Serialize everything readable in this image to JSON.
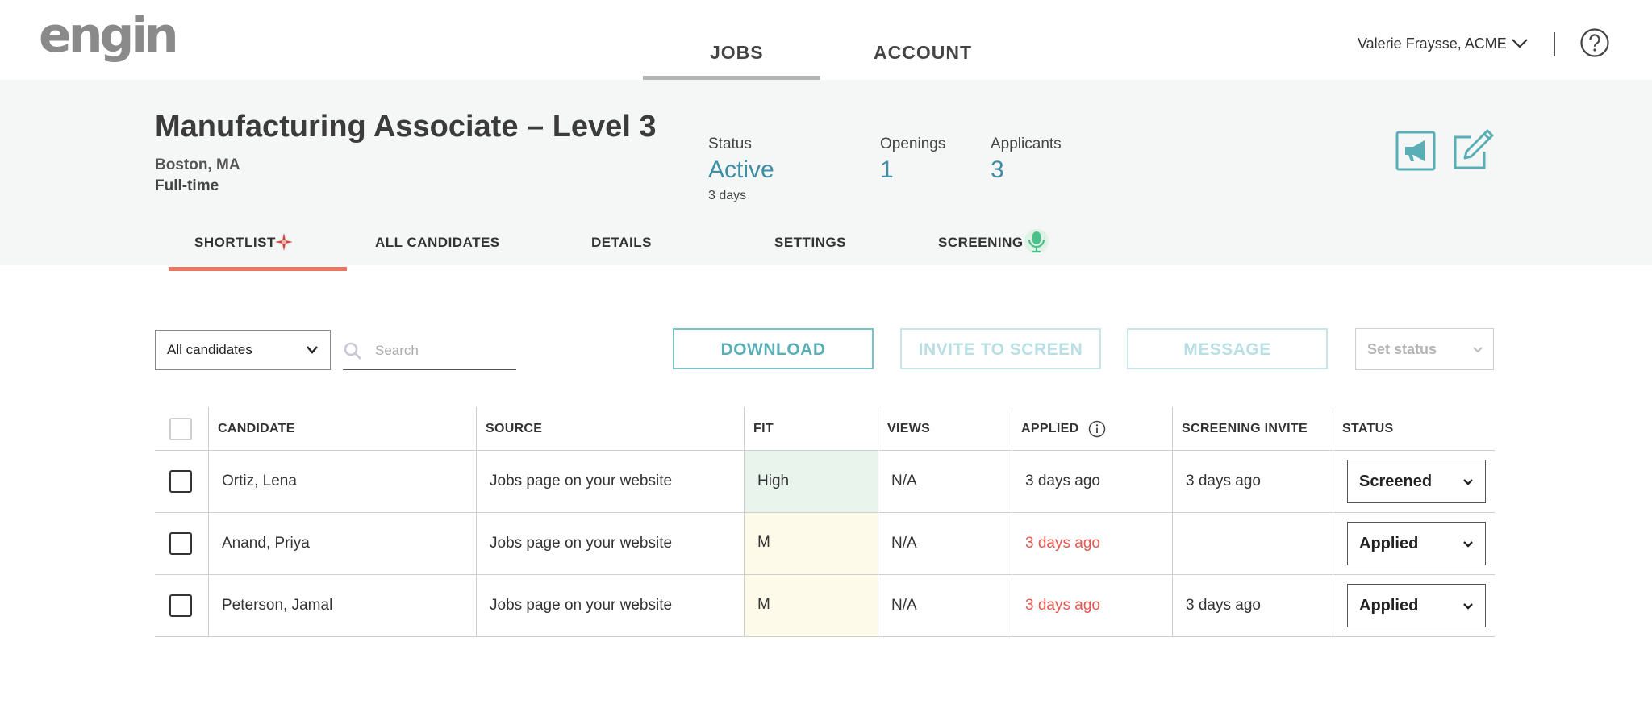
{
  "app": {
    "logo": "engin"
  },
  "nav": {
    "tabs": [
      "JOBS",
      "ACCOUNT"
    ],
    "active": "JOBS"
  },
  "user": {
    "name": "Valerie Fraysse, ACME"
  },
  "job": {
    "title": "Manufacturing Associate – Level 3",
    "location": "Boston, MA",
    "type": "Full-time",
    "status_label": "Status",
    "status_value": "Active",
    "status_age": "3 days",
    "openings_label": "Openings",
    "openings_value": "1",
    "applicants_label": "Applicants",
    "applicants_value": "3"
  },
  "subtabs": [
    "SHORTLIST",
    "ALL CANDIDATES",
    "DETAILS",
    "SETTINGS",
    "SCREENING"
  ],
  "toolbar": {
    "filter_value": "All candidates",
    "search_placeholder": "Search",
    "download": "DOWNLOAD",
    "invite": "INVITE TO SCREEN",
    "message": "MESSAGE",
    "set_status": "Set status"
  },
  "table": {
    "headers": [
      "CANDIDATE",
      "SOURCE",
      "FIT",
      "VIEWS",
      "APPLIED",
      "SCREENING INVITE",
      "STATUS"
    ],
    "rows": [
      {
        "candidate": "Ortiz, Lena",
        "source": "Jobs page on your website",
        "fit": "High",
        "views": "N/A",
        "applied": "3 days ago",
        "invite": "3 days ago",
        "status": "Screened"
      },
      {
        "candidate": "Anand, Priya",
        "source": "Jobs page on your website",
        "fit": "M",
        "views": "N/A",
        "applied": "3 days ago",
        "invite": "",
        "status": "Applied"
      },
      {
        "candidate": "Peterson, Jamal",
        "source": "Jobs page on your website",
        "fit": "M",
        "views": "N/A",
        "applied": "3 days ago",
        "invite": "3 days ago",
        "status": "Applied"
      }
    ]
  },
  "colors": {
    "accent_teal": "#3e8fa6",
    "tab_underline": "#ef7462",
    "late_red": "#e4584f",
    "fit_high_bg": "#e8f4ec",
    "fit_medium_bg": "#fdfaea"
  }
}
